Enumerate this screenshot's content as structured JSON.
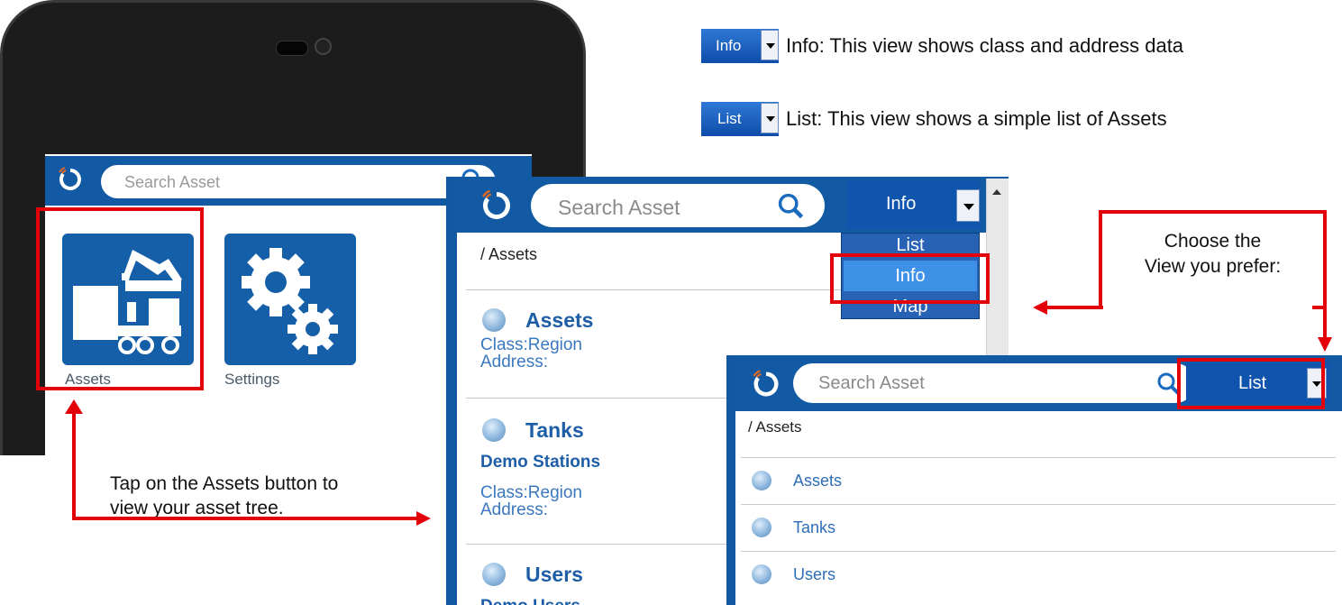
{
  "phone": {
    "search_placeholder": "Search Asset",
    "tiles": [
      {
        "label": "Assets",
        "icon": "assets-icon"
      },
      {
        "label": "Settings",
        "icon": "settings-icon"
      }
    ]
  },
  "legend": {
    "info_button": "Info",
    "info_text": "Info: This view shows class and address data",
    "list_button": "List",
    "list_text": "List: This view shows a simple list of Assets"
  },
  "info_view": {
    "search_placeholder": "Search Asset",
    "view_selected": "Info",
    "breadcrumb": "/ Assets",
    "menu": [
      "List",
      "Info",
      "Map"
    ],
    "items": [
      {
        "title": "Assets",
        "subtitle": "",
        "class": "Class:Region",
        "address": "Address:"
      },
      {
        "title": "Tanks",
        "subtitle": "Demo Stations",
        "class": "Class:Region",
        "address": "Address:"
      },
      {
        "title": "Users",
        "subtitle": "Demo Users",
        "class": "",
        "address": ""
      }
    ]
  },
  "list_view": {
    "search_placeholder": "Search Asset",
    "view_selected": "List",
    "breadcrumb": "/ Assets",
    "items": [
      "Assets",
      "Tanks",
      "Users"
    ]
  },
  "callouts": {
    "choose_view": "Choose the View you prefer:",
    "choose_line1": "Choose the",
    "choose_line2": "View you prefer:",
    "tap_line1": "Tap on the Assets button to",
    "tap_line2": "view your asset tree."
  },
  "colors": {
    "brand_blue": "#125aa3",
    "callout_red": "#e3000b"
  }
}
